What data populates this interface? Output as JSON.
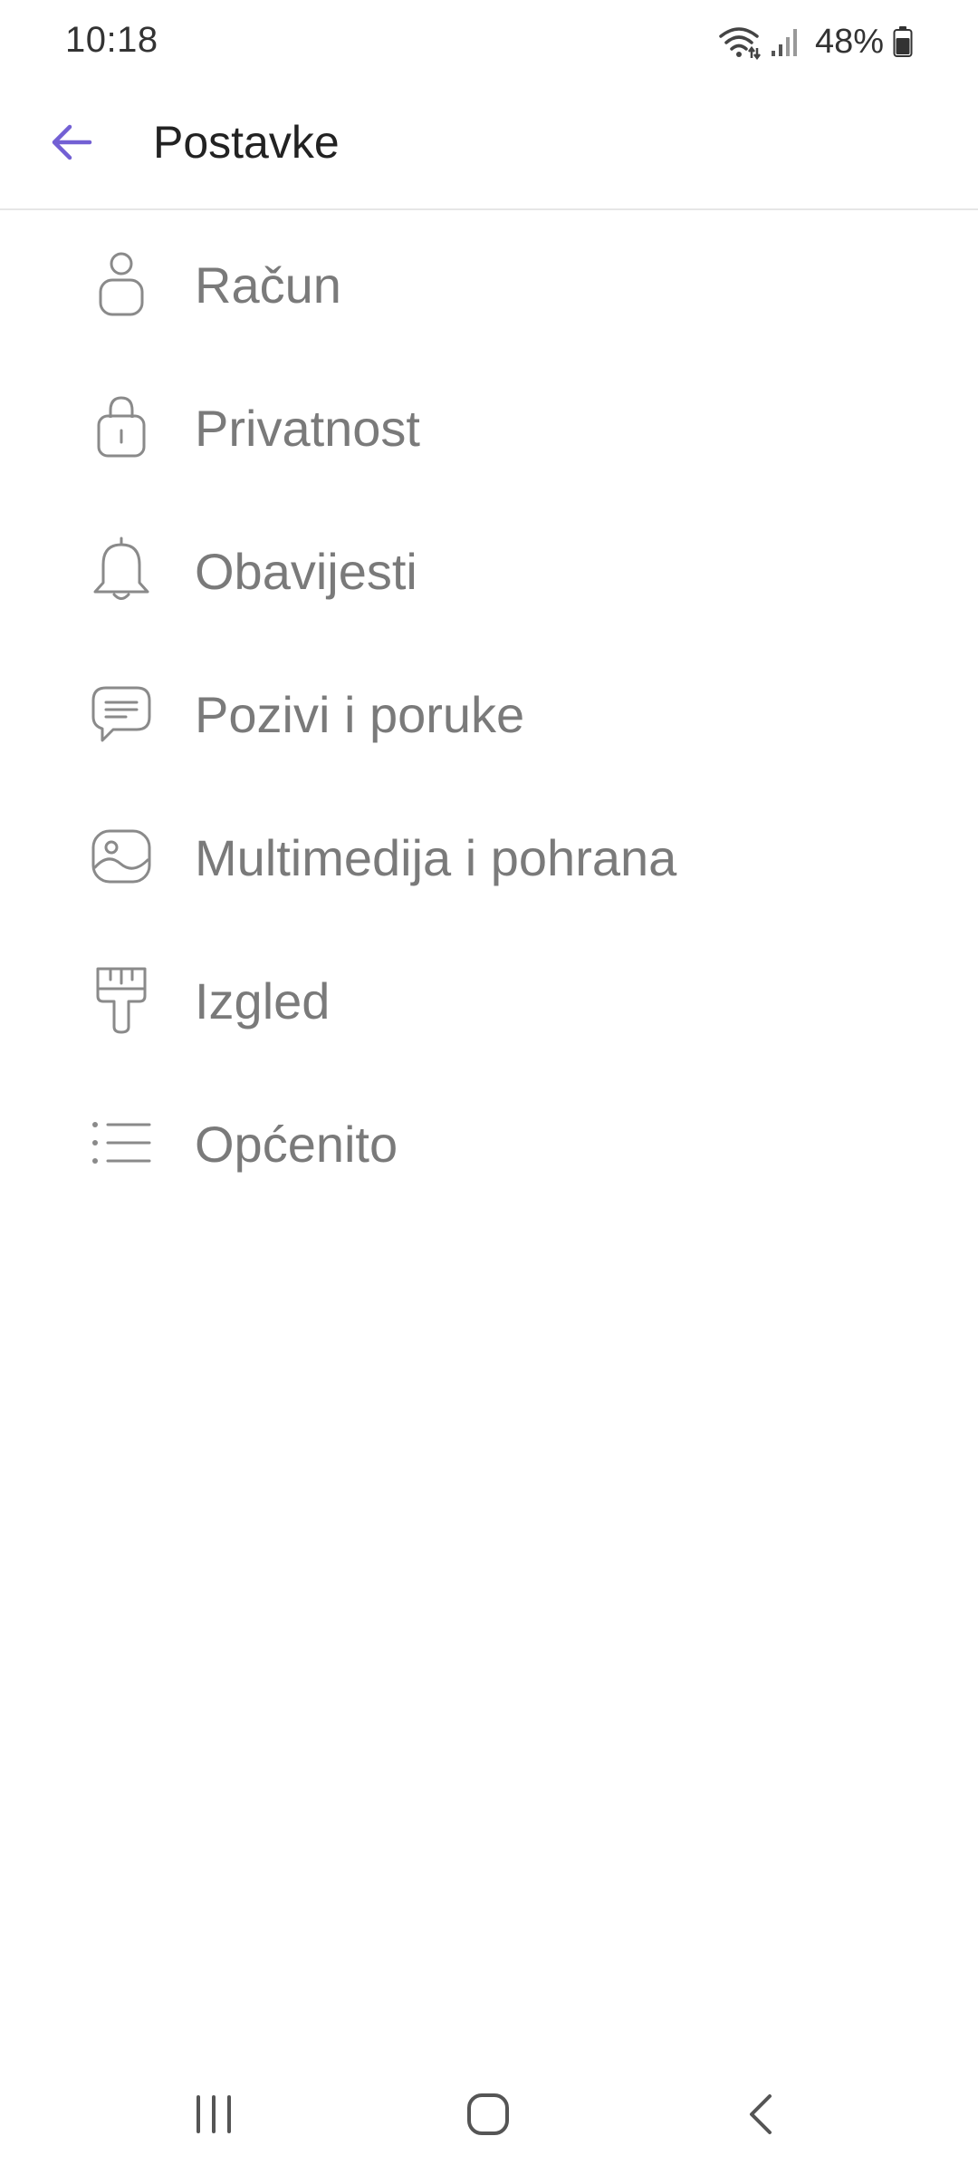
{
  "status_bar": {
    "time": "10:18",
    "battery_percent": "48%",
    "battery_level": 0.48,
    "icons": [
      "wifi-icon",
      "signal-icon",
      "battery-icon"
    ]
  },
  "app_bar": {
    "title": "Postavke",
    "back_icon": "arrow-left-icon"
  },
  "colors": {
    "accent": "#7360d4",
    "text_primary": "#222222",
    "text_secondary": "#7a7a7a",
    "icon": "#8a8a8a",
    "divider": "#e6e6e6"
  },
  "settings": {
    "items": [
      {
        "label": "Račun",
        "icon": "person-icon"
      },
      {
        "label": "Privatnost",
        "icon": "lock-icon"
      },
      {
        "label": "Obavijesti",
        "icon": "bell-icon"
      },
      {
        "label": "Pozivi i poruke",
        "icon": "chat-bubble-icon"
      },
      {
        "label": "Multimedija i pohrana",
        "icon": "image-icon"
      },
      {
        "label": "Izgled",
        "icon": "paintbrush-icon"
      },
      {
        "label": "Općenito",
        "icon": "list-icon"
      }
    ]
  },
  "nav_bar": {
    "buttons": [
      "recents-icon",
      "home-icon",
      "back-chevron-icon"
    ]
  }
}
